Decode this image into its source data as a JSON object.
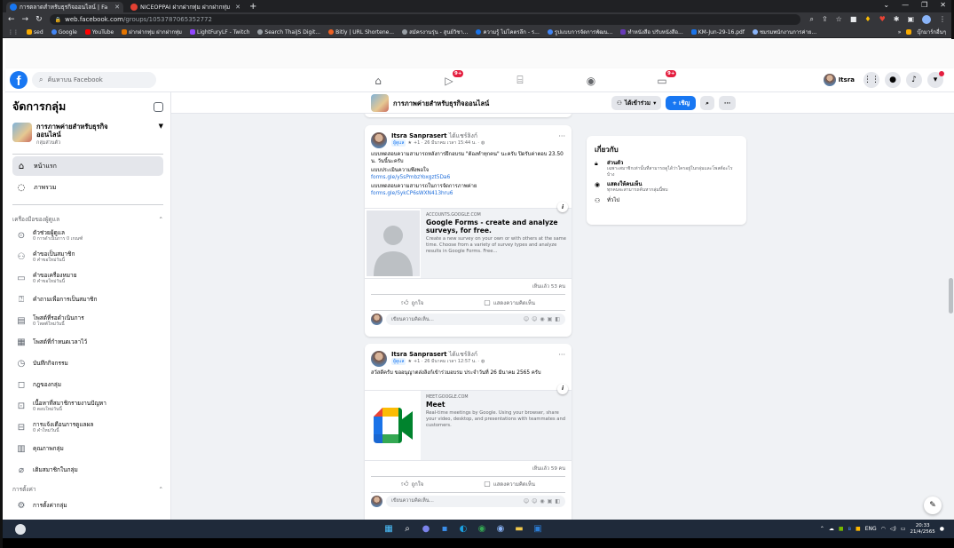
{
  "browser": {
    "tabs": [
      {
        "title": "การตลาดสำหรับธุรกิจออนไลน์ | Fa",
        "active": true
      },
      {
        "title": "NICEOPPAI ฝากฝากทุ่ม ฝากฝากทุ่ม",
        "active": false
      }
    ],
    "url_host": "web.facebook.com",
    "url_path": "/groups/1053787065352772",
    "bookmarks": [
      "sed",
      "Google",
      "YouTube",
      "ฝากฝากทุ่ม ฝากฝากทุ่ม",
      "LightFuryLF - Twitch",
      "Search ThaiJS Digit...",
      "Bitly | URL Shortene...",
      "สมัครงานรุ่น - สูนย์วิชา...",
      "ความรู้ ไม่โคตรลึก - ร...",
      "รูปแบบการจัดการพัฒน...",
      "ทำหนังสือ ปรับหนังสือ...",
      "KM-Jun-29-16.pdf",
      "ชมรมพนักงานการค่าย..."
    ],
    "bookmarks_right": "บุ๊กมาร์กอื่นๆ"
  },
  "fb": {
    "search_placeholder": "ค้นหาบน Facebook",
    "notif_badge_1": "9+",
    "notif_badge_2": "9+",
    "profile_name": "Itsra"
  },
  "sidebar": {
    "title": "จัดการกลุ่ม",
    "group_name": "การภาพค่ายสำหรับธุรกิจออนไลน์",
    "group_type": "กลุ่มส่วนตัว",
    "nav": [
      {
        "label": "หน้าแรก"
      },
      {
        "label": "ภาพรวม"
      }
    ],
    "tools_header": "เครื่องมือของผู้ดูแล",
    "tools": [
      {
        "label": "ตัวช่วยผู้ดูแล",
        "sub": "0 การดำเนินการ 0 เกณฑ์"
      },
      {
        "label": "คำขอเป็นสมาชิก",
        "sub": "0 คำขอใหม่วันนี้"
      },
      {
        "label": "คำขอเครื่องหมาย",
        "sub": "0 คำขอใหม่วันนี้"
      },
      {
        "label": "คำถามเพื่อการเป็นสมาชิก",
        "sub": ""
      },
      {
        "label": "โพสต์ที่รอดำเนินการ",
        "sub": "0 โพสต์ใหม่วันนี้"
      },
      {
        "label": "โพสต์ที่กำหนดเวลาไว้",
        "sub": ""
      },
      {
        "label": "บันทึกกิจกรรม",
        "sub": ""
      },
      {
        "label": "กฎของกลุ่ม",
        "sub": ""
      },
      {
        "label": "เนื้อหาที่สมาชิกรายงานปัญหา",
        "sub": "0 ตอบใหม่วันนี้"
      },
      {
        "label": "การแจ้งเตือนการดูแลผล",
        "sub": "0 คำใหม่วันนี้"
      },
      {
        "label": "คุณภาพกลุ่ม",
        "sub": ""
      },
      {
        "label": "เติมสมาชิกในกลุ่ม",
        "sub": ""
      }
    ],
    "settings_header": "การตั้งค่า",
    "settings_item": "การตั้งค่ากลุ่ม"
  },
  "group_bar": {
    "name": "การภาพค่ายสำหรับธุรกิจออนไลน์",
    "joined_label": "ได้เข้าร่วม",
    "invite_label": "+ เชิญ"
  },
  "posts": [
    {
      "author": "Itsra Sanprasert",
      "verb": "ได้แชร์ลิงก์",
      "role": "ผู้ดูแล",
      "meta": "+1 · 26 มีนาคม เวลา 15:44 น. ·",
      "body_1": "แบบทดสอบความสามารถหลังการฝึกอบรม \"ต้องทำทุกคน\" นะครับ ปิดรับค่าตอบ 23.50 น. วันนี้นะครับ",
      "body_2": "แบบประเมินความพึงพอใจ",
      "link_1": "forms.gle/y5sPmbzYoxgzt5Da6",
      "body_3": "แบบทดสอบความสามารถในการจัดการภาพค่าย",
      "link_2": "forms.gle/SykCP6sWXN413hru6",
      "lp_domain": "ACCOUNTS.GOOGLE.COM",
      "lp_title": "Google Forms - create and analyze surveys, for free.",
      "lp_desc": "Create a new survey on your own or with others at the same time. Choose from a variety of survey types and analyze results in Google Forms. Free...",
      "seen": "เห็นแล้ว 53 คน",
      "like_label": "ถูกใจ",
      "comment_label": "แสดงความคิดเห็น",
      "comment_placeholder": "เขียนความคิดเห็น..."
    },
    {
      "author": "Itsra Sanprasert",
      "verb": "ได้แชร์ลิงก์",
      "role": "ผู้ดูแล",
      "meta": "+1 · 26 มีนาคม เวลา 12:57 น. ·",
      "body_1": "สวัสดีครับ ขออนุญาตส่งลิงก์เข้าร่วมอบรม ประจำวันที่ 26 มีนาคม 2565 ครับ",
      "lp_domain": "MEET.GOOGLE.COM",
      "lp_title": "Meet",
      "lp_desc": "Real-time meetings by Google. Using your browser, share your video, desktop, and presentations with teammates and customers.",
      "seen": "เห็นแล้ว 59 คน",
      "like_label": "ถูกใจ",
      "comment_label": "แสดงความคิดเห็น",
      "comment_placeholder": "เขียนความคิดเห็น..."
    }
  ],
  "about": {
    "title": "เกี่ยวกับ",
    "private_title": "ส่วนตัว",
    "private_desc": "เฉพาะสมาชิกเท่านั้นที่สามารถดูได้ว่าใครอยู่ในกลุ่มและโพสต์อะไรบ้าง",
    "visible_title": "แสดงให้คนเห็น",
    "visible_desc": "ทุกคนจะสามารถค้นหากลุ่มนี้พบ",
    "general": "ทั่วไป"
  },
  "taskbar": {
    "lang": "ENG",
    "time": "20:33",
    "date": "21/4/2565"
  }
}
